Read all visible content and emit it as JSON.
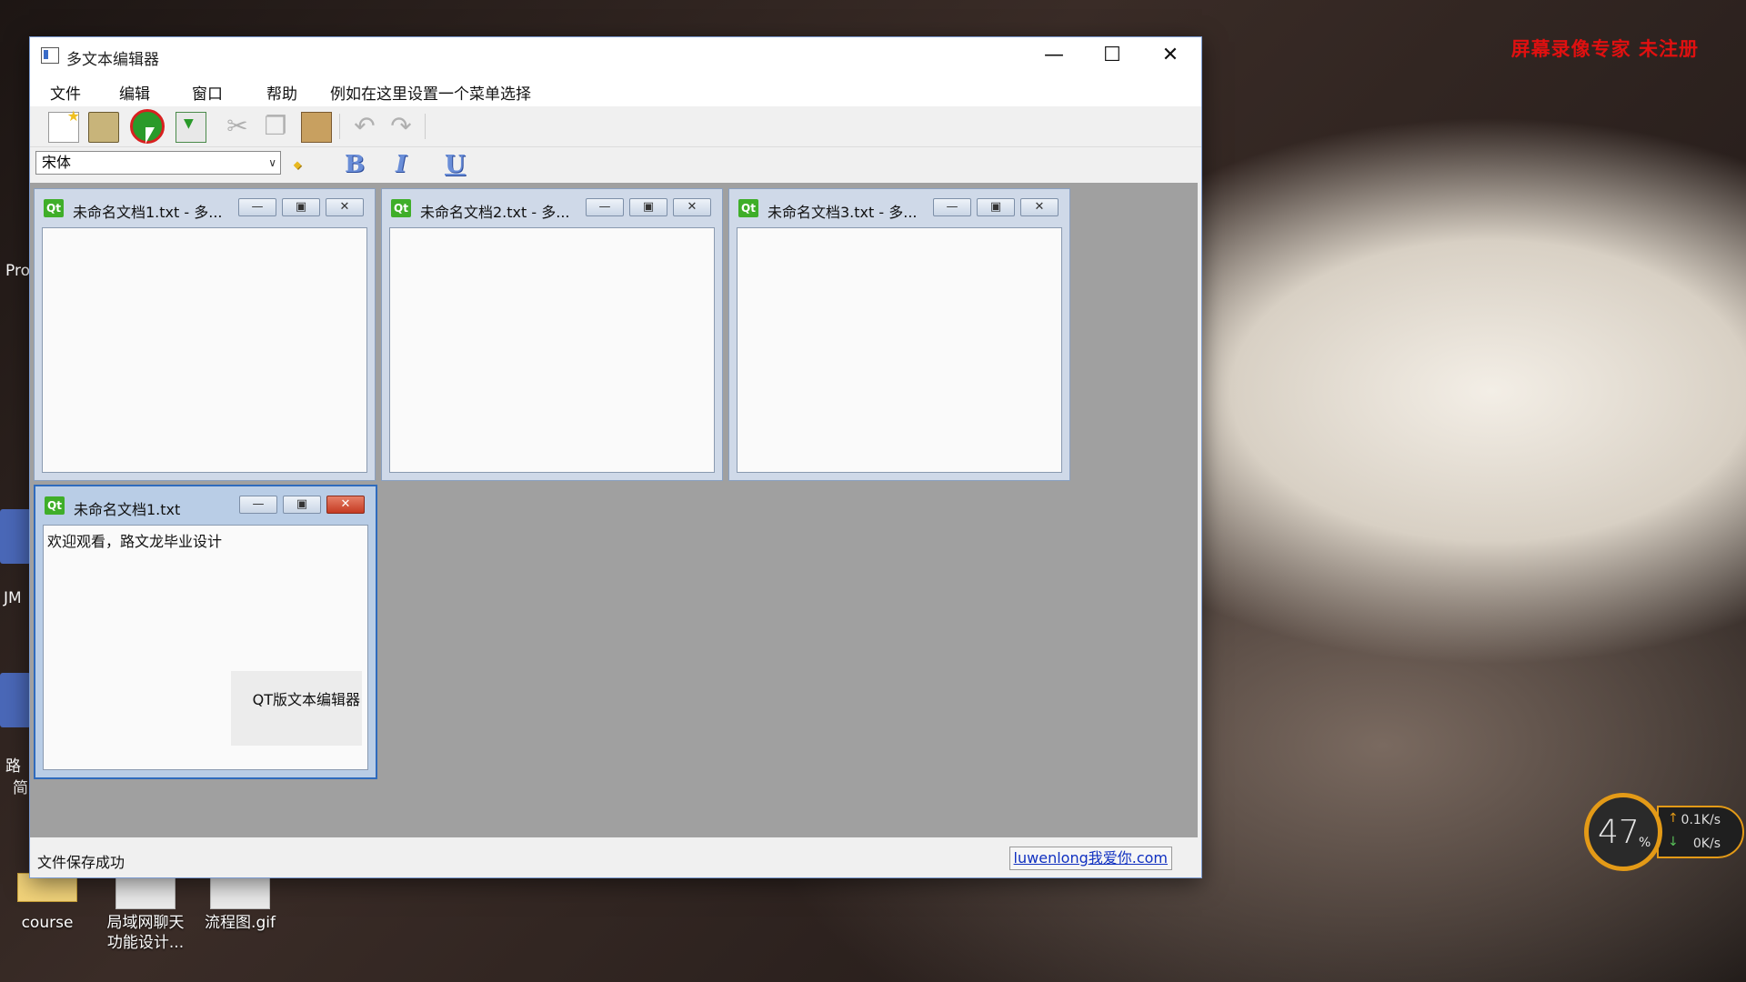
{
  "watermark": "屏幕录像专家  未注册",
  "desktop": {
    "icons": [
      {
        "label": "course"
      },
      {
        "label": "局域网聊天功能设计..."
      },
      {
        "label": "流程图.gif"
      }
    ],
    "partial_labels": [
      "Pro",
      "JM",
      "路",
      "简"
    ]
  },
  "net_monitor": {
    "percent": "47",
    "percent_unit": "%",
    "upload": "0.1K/s",
    "download": "0K/s"
  },
  "window": {
    "title": "多文本编辑器",
    "menu": [
      "文件",
      "编辑",
      "窗口",
      "帮助",
      "例如在这里设置一个菜单选择"
    ],
    "font_combo": "宋体",
    "format_buttons": [
      "B",
      "I",
      "U"
    ],
    "status": "文件保存成功",
    "status_link": "luwenlong我爱你.com"
  },
  "subwindows": [
    {
      "title": "未命名文档1.txt - 多..."
    },
    {
      "title": "未命名文档2.txt - 多..."
    },
    {
      "title": "未命名文档3.txt - 多..."
    },
    {
      "title": "未命名文档1.txt",
      "content": "欢迎观看，路文龙毕业设计",
      "footer": "QT版文本编辑器"
    }
  ]
}
